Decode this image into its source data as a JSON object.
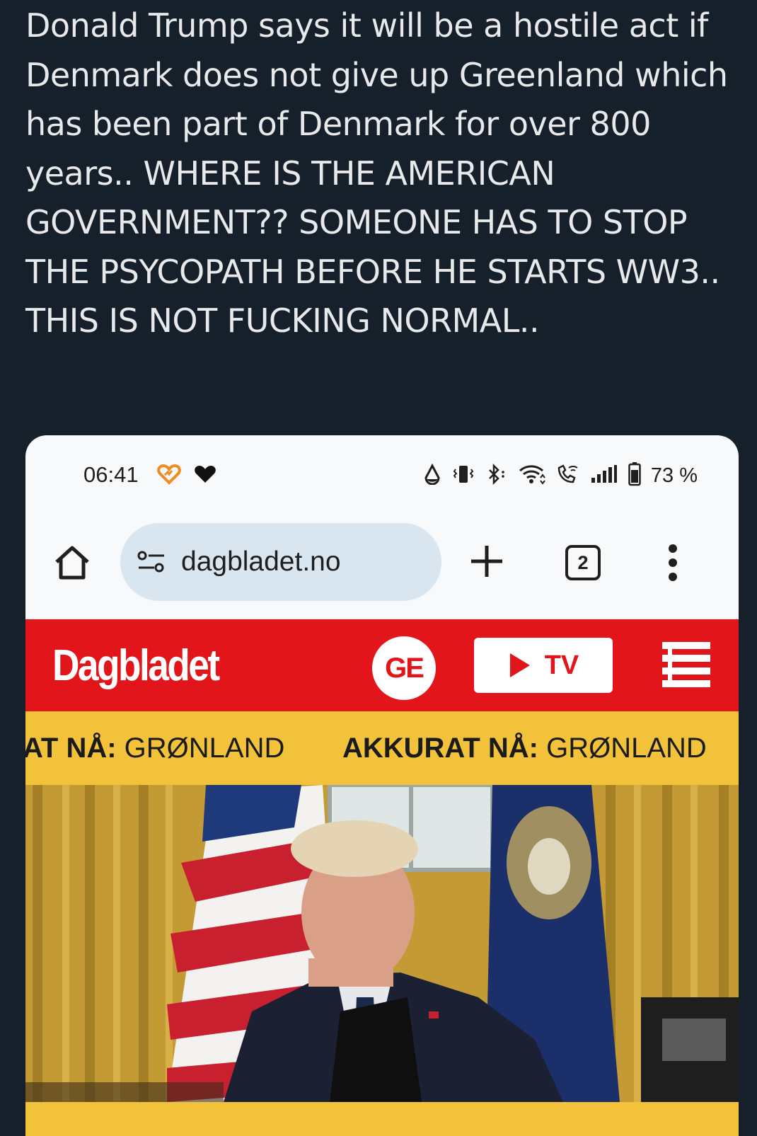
{
  "post": {
    "text": "Donald Trump says it will be a hostile act if Denmark does not give up Greenland which has been part of Denmark for over 800 years.. WHERE IS THE AMERICAN GOVERNMENT?? SOMEONE HAS TO STOP THE PSYCOPATH BEFORE HE STARTS WW3.. THIS IS NOT FUCKING NORMAL.."
  },
  "screenshot": {
    "status_bar": {
      "time": "06:41",
      "battery": "73 %",
      "icons": [
        "heart-outline-icon",
        "heart-icon",
        "alarm-icon",
        "vibrate-icon",
        "bluetooth-icon",
        "wifi-icon",
        "wifi-calling-icon",
        "signal-icon",
        "battery-icon"
      ]
    },
    "browser": {
      "url": "dagbladet.no",
      "tab_count": "2",
      "icons": [
        "home-icon",
        "site-settings-icon",
        "new-tab-icon",
        "kebab-menu-icon"
      ]
    },
    "site": {
      "logo": "Dagbladet",
      "ge_label": "GE",
      "tv_label": "TV",
      "colors": {
        "brand_red": "#e2151b",
        "ticker_yellow": "#f2c23b"
      }
    },
    "ticker": {
      "item1_prefix": "AT NÅ:",
      "item1_topic": " GRØNLAND",
      "item2_prefix": "AKKURAT NÅ:",
      "item2_topic": " GRØNLAND"
    }
  }
}
